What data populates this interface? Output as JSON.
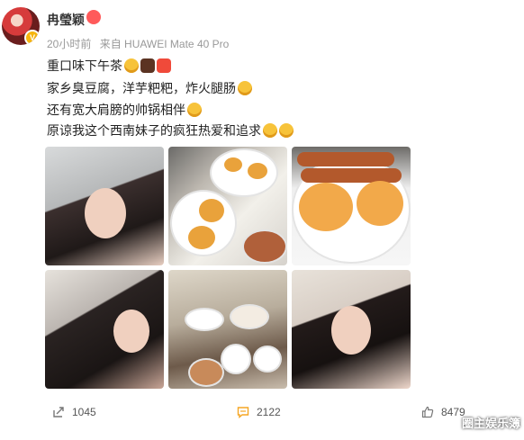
{
  "post": {
    "username": "冉瑩颖",
    "time": "20小时前",
    "source": "来自 HUAWEI Mate 40 Pro",
    "lines": [
      "重口味下午茶",
      "家乡臭豆腐，洋芋粑粑，炸火腿肠",
      "还有宽大肩膀的帅锅相伴",
      "原谅我这个西南妹子的疯狂热爱和追求"
    ]
  },
  "actions": {
    "repost_count": "1045",
    "comment_count": "2122",
    "like_count": "8479"
  },
  "watermark": "圈主娱乐簿",
  "icons": {
    "avatar_badge": "verified-v-icon",
    "repost": "share-arrow-icon",
    "comment": "comment-bubble-icon",
    "like": "thumbs-up-icon"
  },
  "colors": {
    "comment_accent": "#f5a623",
    "badge": "#f6b50e"
  }
}
